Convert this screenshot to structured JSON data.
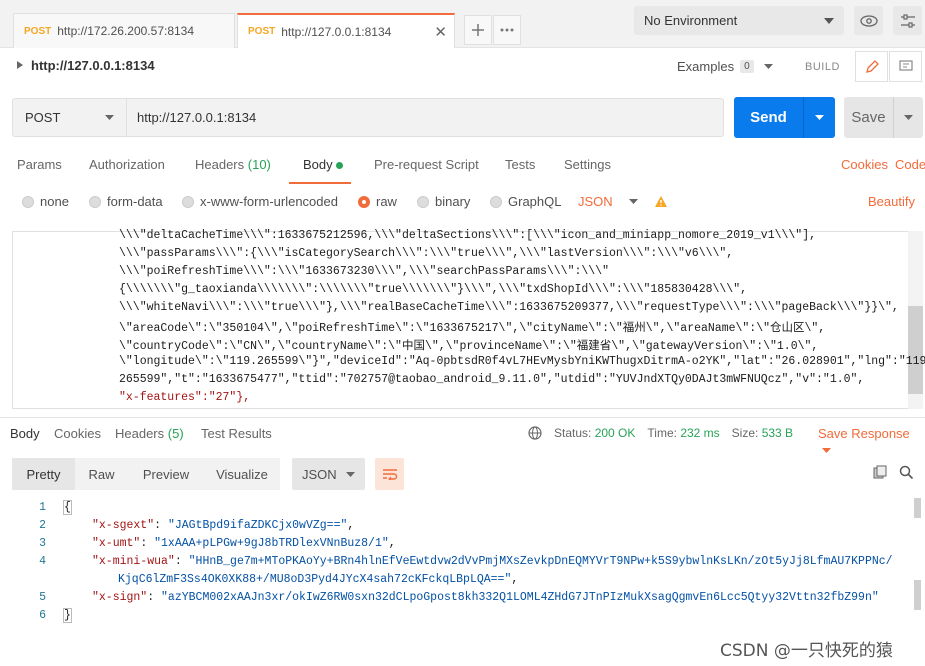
{
  "tabs": [
    {
      "method": "POST",
      "url": "http://172.26.200.57:8134"
    },
    {
      "method": "POST",
      "url": "http://127.0.0.1:8134"
    }
  ],
  "environment": "No Environment",
  "request": {
    "title": "http://127.0.0.1:8134",
    "examples_label": "Examples",
    "examples_count": "0",
    "build_label": "BUILD",
    "method": "POST",
    "url": "http://127.0.0.1:8134",
    "send_label": "Send",
    "save_label": "Save"
  },
  "request_tabs": {
    "params": "Params",
    "authorization": "Authorization",
    "headers": "Headers",
    "headers_count": "(10)",
    "body": "Body",
    "prerequest": "Pre-request Script",
    "tests": "Tests",
    "settings": "Settings",
    "cookies": "Cookies",
    "code": "Code"
  },
  "body_types": {
    "none": "none",
    "form_data": "form-data",
    "urlencoded": "x-www-form-urlencoded",
    "raw": "raw",
    "binary": "binary",
    "graphql": "GraphQL",
    "format": "JSON",
    "beautify": "Beautify"
  },
  "request_body_lines": [
    "\\\\\\\"deltaCacheTime\\\\\\\":1633675212596,\\\\\\\"deltaSections\\\\\\\":[\\\\\\\"icon_and_miniapp_nomore_2019_v1\\\\\\\"],",
    "\\\\\\\"passParams\\\\\\\":{\\\\\\\"isCategorySearch\\\\\\\":\\\\\\\"true\\\\\\\",\\\\\\\"lastVersion\\\\\\\":\\\\\\\"v6\\\\\\\",",
    "\\\\\\\"poiRefreshTime\\\\\\\":\\\\\\\"1633673230\\\\\\\",\\\\\\\"searchPassParams\\\\\\\":\\\\\\\"",
    "{\\\\\\\\\\\\\\\"g_taoxianda\\\\\\\\\\\\\\\":\\\\\\\\\\\\\\\"true\\\\\\\\\\\\\\\"}\\\\\\\",\\\\\\\"txdShopId\\\\\\\":\\\\\\\"185830428\\\\\\\",",
    "\\\\\\\"whiteNavi\\\\\\\":\\\\\\\"true\\\\\\\"},\\\\\\\"realBaseCacheTime\\\\\\\":1633675209377,\\\\\\\"requestType\\\\\\\":\\\\\\\"pageBack\\\\\\\"}}\\\",",
    "\\\"areaCode\\\":\\\"350104\\\",\\\"poiRefreshTime\\\":\\\"1633675217\\\",\\\"cityName\\\":\\\"福州\\\",\\\"areaName\\\":\\\"仓山区\\\",",
    "\\\"countryCode\\\":\\\"CN\\\",\\\"countryName\\\":\\\"中国\\\",\\\"provinceName\\\":\\\"福建省\\\",\\\"gatewayVersion\\\":\\\"1.0\\\",",
    "\\\"longitude\\\":\\\"119.265599\\\"}\",\"deviceId\":\"Aq-0pbtsdR0f4vL7HEvMysbYniKWThugxDitrmA-o2YK\",\"lat\":\"26.028901\",\"lng\":\"119.",
    "265599\",\"t\":\"1633675477\",\"ttid\":\"702757@taobao_android_9.11.0\",\"utdid\":\"YUVJndXTQy0DAJt3mWFNUQcz\",\"v\":\"1.0\",",
    "\"x-features\":\"27\"},"
  ],
  "response_tabs": {
    "body": "Body",
    "cookies": "Cookies",
    "headers": "Headers",
    "headers_count": "(5)",
    "test_results": "Test Results"
  },
  "response_status": {
    "status_label": "Status:",
    "status_value": "200 OK",
    "time_label": "Time:",
    "time_value": "232 ms",
    "size_label": "Size:",
    "size_value": "533 B",
    "save_response": "Save Response"
  },
  "view_modes": {
    "pretty": "Pretty",
    "raw": "Raw",
    "preview": "Preview",
    "visualize": "Visualize",
    "format": "JSON"
  },
  "response_body": {
    "line_numbers": [
      "1",
      "2",
      "3",
      "4",
      "",
      "5",
      "6"
    ],
    "open_brace": "{",
    "close_brace": "}",
    "x_sgext_key": "\"x-sgext\"",
    "x_sgext_value": "\"JAGtBpd9ifaZDKCjx0wVZg==\"",
    "x_umt_key": "\"x-umt\"",
    "x_umt_value": "\"1xAAA+pLPGw+9gJ8bTRDlexVNnBuz8/1\"",
    "x_mini_wua_key": "\"x-mini-wua\"",
    "x_mini_wua_value_1": "\"HHnB_ge7m+MToPKAoYy+BRn4hlnEfVeEwtdvw2dVvPmjMXsZevkpDnEQMYVrT9NPw+k5S9ybwlnKsLKn/zOt5yJj8LfmAU7KPPNc/",
    "x_mini_wua_value_2": "KjqC6lZmF3Ss4OK0XK88+/MU8oD3Pyd4JYcX4sah72cKFckqLBpLQA==\"",
    "x_sign_key": "\"x-sign\"",
    "x_sign_value": "\"azYBCM002xAAJn3xr/okIwZ6RW0sxn32dCLpoGpost8kh332Q1LOML4ZHdG7JTnPIzMukXsagQgmvEn6Lcc5Qtyy32Vttn32fbZ99n\""
  },
  "watermark": "CSDN @一只快死的猿"
}
